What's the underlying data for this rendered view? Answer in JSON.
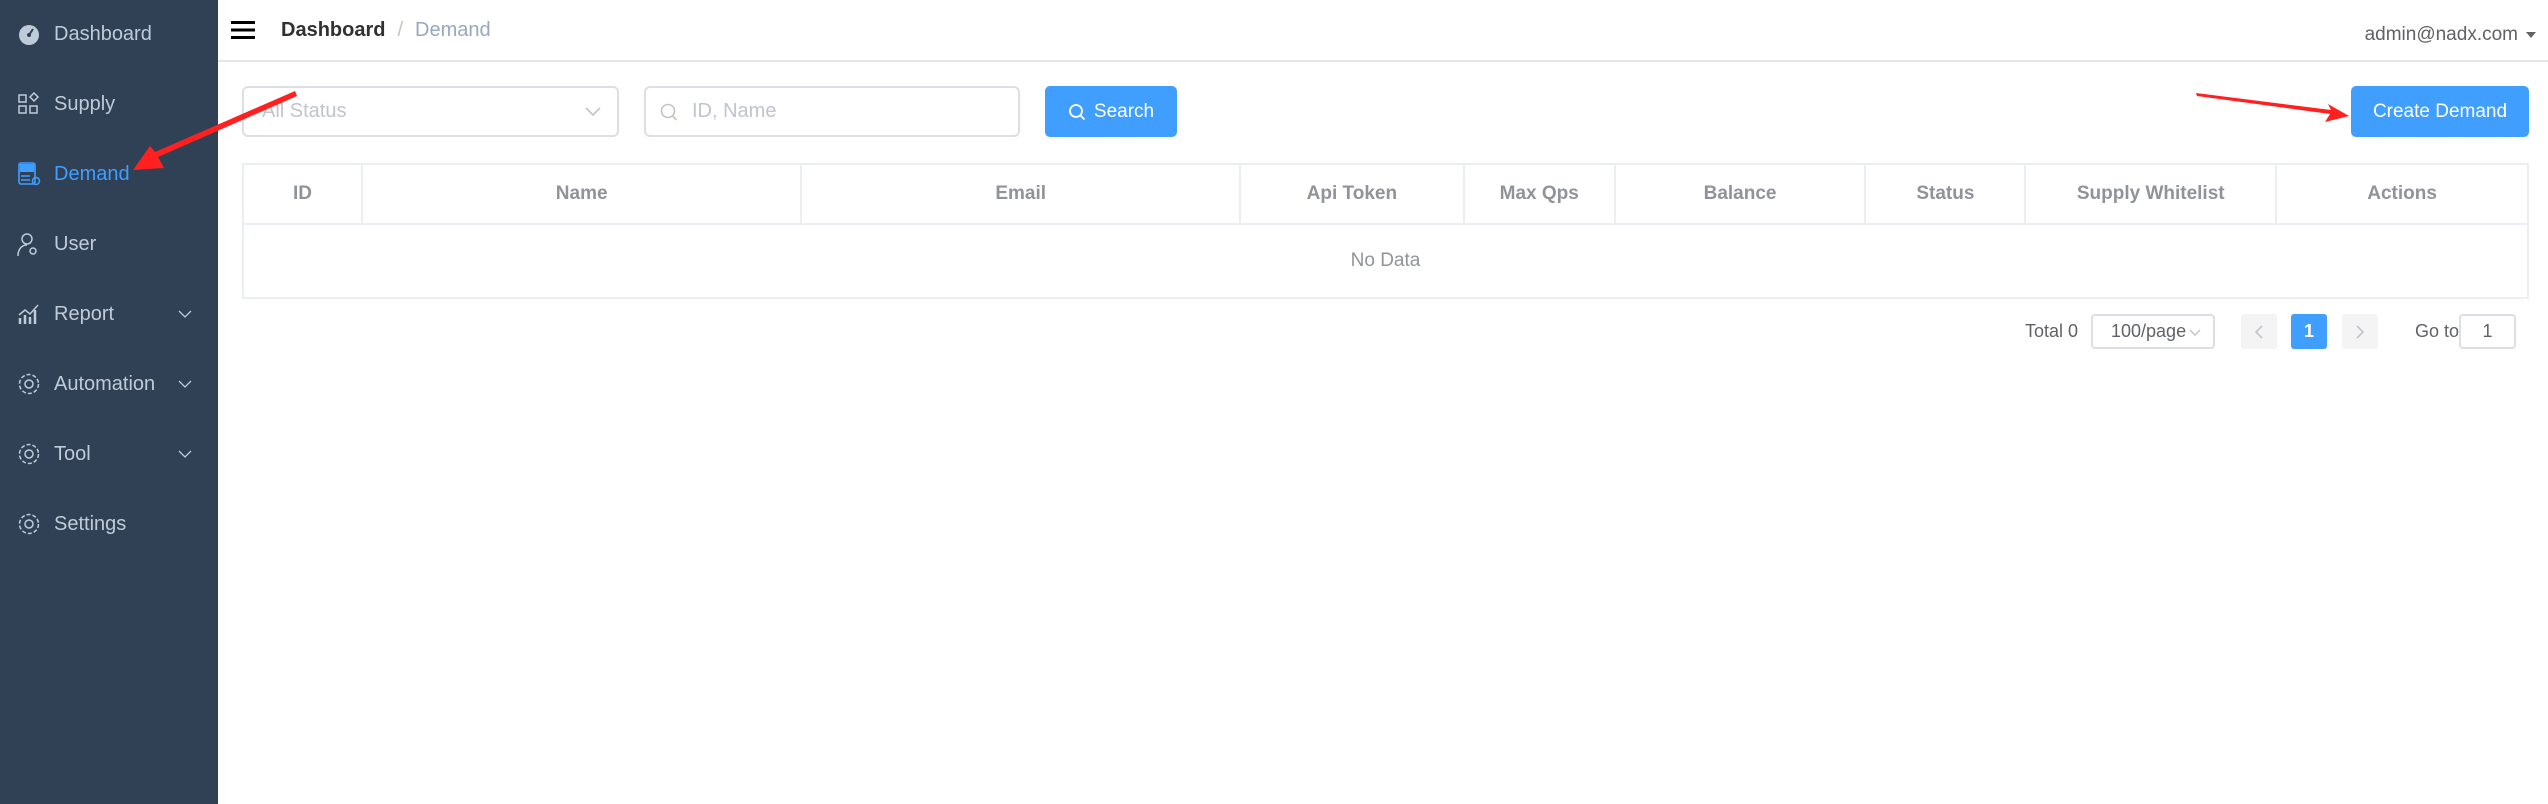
{
  "sidebar": {
    "items": [
      {
        "label": "Dashboard",
        "icon": "dashboard-icon"
      },
      {
        "label": "Supply",
        "icon": "grid-icon"
      },
      {
        "label": "Demand",
        "icon": "ad-icon",
        "active": true
      },
      {
        "label": "User",
        "icon": "user-icon"
      },
      {
        "label": "Report",
        "icon": "chart-icon",
        "expandable": true
      },
      {
        "label": "Automation",
        "icon": "gear-icon",
        "expandable": true
      },
      {
        "label": "Tool",
        "icon": "gear-icon",
        "expandable": true
      },
      {
        "label": "Settings",
        "icon": "gear-icon"
      }
    ]
  },
  "header": {
    "breadcrumb": [
      "Dashboard",
      "Demand"
    ],
    "separator": "/",
    "user": "admin@nadx.com"
  },
  "filters": {
    "status_placeholder": "All Status",
    "search_placeholder": "ID, Name",
    "search_label": "Search",
    "create_label": "Create Demand"
  },
  "table": {
    "columns": [
      "ID",
      "Name",
      "Email",
      "Api Token",
      "Max Qps",
      "Balance",
      "Status",
      "Supply Whitelist",
      "Actions"
    ],
    "empty": "No Data"
  },
  "pagination": {
    "total": "Total 0",
    "page_size": "100/page",
    "current": "1",
    "goto_label": "Go to",
    "goto_value": "1"
  },
  "colors": {
    "sidebar": "#304156",
    "accent": "#409eff",
    "annotation": "#ff2020"
  }
}
